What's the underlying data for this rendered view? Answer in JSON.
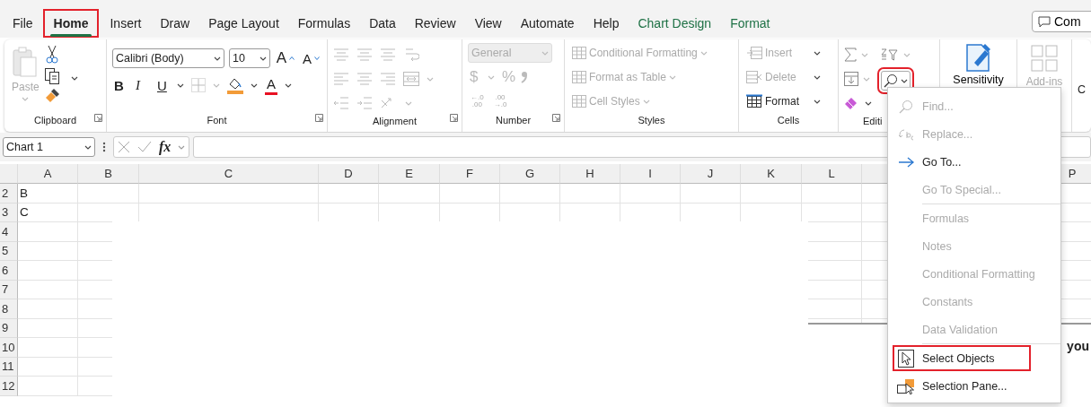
{
  "tabs": [
    {
      "label": "File",
      "selected": false,
      "contextual": false,
      "highlighted": false
    },
    {
      "label": "Home",
      "selected": true,
      "contextual": false,
      "highlighted": true
    },
    {
      "label": "Insert",
      "selected": false,
      "contextual": false,
      "highlighted": false
    },
    {
      "label": "Draw",
      "selected": false,
      "contextual": false,
      "highlighted": false
    },
    {
      "label": "Page Layout",
      "selected": false,
      "contextual": false,
      "highlighted": false
    },
    {
      "label": "Formulas",
      "selected": false,
      "contextual": false,
      "highlighted": false
    },
    {
      "label": "Data",
      "selected": false,
      "contextual": false,
      "highlighted": false
    },
    {
      "label": "Review",
      "selected": false,
      "contextual": false,
      "highlighted": false
    },
    {
      "label": "View",
      "selected": false,
      "contextual": false,
      "highlighted": false
    },
    {
      "label": "Automate",
      "selected": false,
      "contextual": false,
      "highlighted": false
    },
    {
      "label": "Help",
      "selected": false,
      "contextual": false,
      "highlighted": false
    },
    {
      "label": "Chart Design",
      "selected": false,
      "contextual": true,
      "highlighted": false
    },
    {
      "label": "Format",
      "selected": false,
      "contextual": true,
      "highlighted": false
    }
  ],
  "comments_button": {
    "label": "Com"
  },
  "ribbon": {
    "clipboard": {
      "label": "Clipboard",
      "paste": {
        "label": "Paste",
        "disabled": true
      }
    },
    "font": {
      "label": "Font",
      "font_name": "Calibri (Body)",
      "font_size": "10",
      "grow": "A",
      "shrink": "A",
      "bold": "B",
      "italic": "I",
      "underline": "U",
      "font_color": "A"
    },
    "alignment": {
      "label": "Alignment",
      "disabled": true
    },
    "number": {
      "label": "Number",
      "format": "General",
      "currency": "$",
      "percent": "%",
      "decimal_buttons": [
        {
          "top": "←.0",
          "bottom": ".00"
        },
        {
          "top": ".00",
          "bottom": "→.0"
        }
      ],
      "disabled": true
    },
    "styles": {
      "label": "Styles",
      "items": [
        {
          "label": "Conditional Formatting",
          "disabled": true
        },
        {
          "label": "Format as Table",
          "disabled": true
        },
        {
          "label": "Cell Styles",
          "disabled": true
        }
      ]
    },
    "cells": {
      "label": "Cells",
      "items": [
        {
          "label": "Insert",
          "disabled": true
        },
        {
          "label": "Delete",
          "disabled": true
        },
        {
          "label": "Format",
          "disabled": false
        }
      ]
    },
    "editing": {
      "label": "Editi",
      "find_button": {
        "highlighted": true
      }
    },
    "sensitivity": {
      "label": "Sensitivity"
    },
    "addins": {
      "label": "Add-ins",
      "disabled": true
    },
    "cut_label": "C"
  },
  "formula_bar": {
    "name_box": "Chart 1",
    "fx": "fx"
  },
  "sheet": {
    "columns": [
      "A",
      "B",
      "C",
      "D",
      "E",
      "F",
      "G",
      "H",
      "I",
      "J",
      "K",
      "L"
    ],
    "tail_column": "P",
    "rows": [
      {
        "header": "2",
        "cell": "B"
      },
      {
        "header": "3",
        "cell": "C"
      },
      {
        "header": "4"
      },
      {
        "header": "5"
      },
      {
        "header": "6"
      },
      {
        "header": "7"
      },
      {
        "header": "8"
      },
      {
        "header": "9"
      },
      {
        "header": "10"
      },
      {
        "header": "11"
      },
      {
        "header": "12"
      }
    ]
  },
  "chart": {
    "visible_text": "you"
  },
  "menu": {
    "items": [
      {
        "label": "Find...",
        "disabled": true,
        "highlighted": false,
        "separator_before": false
      },
      {
        "label": "Replace...",
        "disabled": true,
        "highlighted": false,
        "separator_before": false
      },
      {
        "label": "Go To...",
        "disabled": false,
        "highlighted": false,
        "separator_before": false
      },
      {
        "label": "Go To Special...",
        "disabled": true,
        "highlighted": false,
        "separator_before": false
      },
      {
        "label": "Formulas",
        "disabled": true,
        "highlighted": false,
        "separator_before": true
      },
      {
        "label": "Notes",
        "disabled": true,
        "highlighted": false,
        "separator_before": false
      },
      {
        "label": "Conditional Formatting",
        "disabled": true,
        "highlighted": false,
        "separator_before": false
      },
      {
        "label": "Constants",
        "disabled": true,
        "highlighted": false,
        "separator_before": false
      },
      {
        "label": "Data Validation",
        "disabled": true,
        "highlighted": false,
        "separator_before": false
      },
      {
        "label": "Select Objects",
        "disabled": false,
        "highlighted": true,
        "separator_before": true
      },
      {
        "label": "Selection Pane...",
        "disabled": false,
        "highlighted": false,
        "separator_before": false
      }
    ]
  }
}
